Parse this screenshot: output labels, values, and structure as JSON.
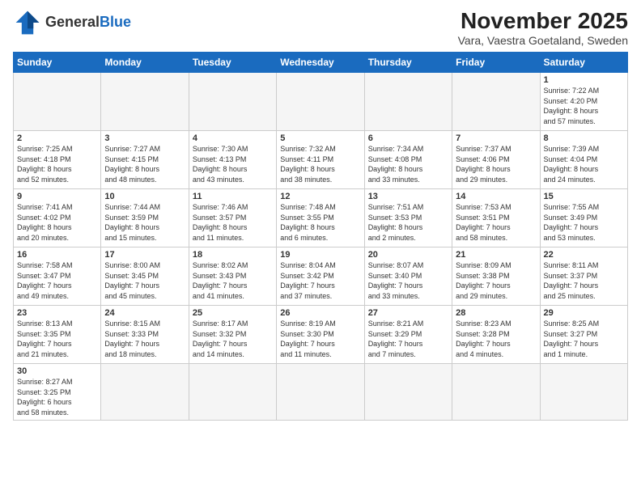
{
  "header": {
    "logo_general": "General",
    "logo_blue": "Blue",
    "title": "November 2025",
    "subtitle": "Vara, Vaestra Goetaland, Sweden"
  },
  "weekdays": [
    "Sunday",
    "Monday",
    "Tuesday",
    "Wednesday",
    "Thursday",
    "Friday",
    "Saturday"
  ],
  "weeks": [
    [
      {
        "day": "",
        "info": "",
        "empty": true
      },
      {
        "day": "",
        "info": "",
        "empty": true
      },
      {
        "day": "",
        "info": "",
        "empty": true
      },
      {
        "day": "",
        "info": "",
        "empty": true
      },
      {
        "day": "",
        "info": "",
        "empty": true
      },
      {
        "day": "",
        "info": "",
        "empty": true
      },
      {
        "day": "1",
        "info": "Sunrise: 7:22 AM\nSunset: 4:20 PM\nDaylight: 8 hours\nand 57 minutes."
      }
    ],
    [
      {
        "day": "2",
        "info": "Sunrise: 7:25 AM\nSunset: 4:18 PM\nDaylight: 8 hours\nand 52 minutes."
      },
      {
        "day": "3",
        "info": "Sunrise: 7:27 AM\nSunset: 4:15 PM\nDaylight: 8 hours\nand 48 minutes."
      },
      {
        "day": "4",
        "info": "Sunrise: 7:30 AM\nSunset: 4:13 PM\nDaylight: 8 hours\nand 43 minutes."
      },
      {
        "day": "5",
        "info": "Sunrise: 7:32 AM\nSunset: 4:11 PM\nDaylight: 8 hours\nand 38 minutes."
      },
      {
        "day": "6",
        "info": "Sunrise: 7:34 AM\nSunset: 4:08 PM\nDaylight: 8 hours\nand 33 minutes."
      },
      {
        "day": "7",
        "info": "Sunrise: 7:37 AM\nSunset: 4:06 PM\nDaylight: 8 hours\nand 29 minutes."
      },
      {
        "day": "8",
        "info": "Sunrise: 7:39 AM\nSunset: 4:04 PM\nDaylight: 8 hours\nand 24 minutes."
      }
    ],
    [
      {
        "day": "9",
        "info": "Sunrise: 7:41 AM\nSunset: 4:02 PM\nDaylight: 8 hours\nand 20 minutes."
      },
      {
        "day": "10",
        "info": "Sunrise: 7:44 AM\nSunset: 3:59 PM\nDaylight: 8 hours\nand 15 minutes."
      },
      {
        "day": "11",
        "info": "Sunrise: 7:46 AM\nSunset: 3:57 PM\nDaylight: 8 hours\nand 11 minutes."
      },
      {
        "day": "12",
        "info": "Sunrise: 7:48 AM\nSunset: 3:55 PM\nDaylight: 8 hours\nand 6 minutes."
      },
      {
        "day": "13",
        "info": "Sunrise: 7:51 AM\nSunset: 3:53 PM\nDaylight: 8 hours\nand 2 minutes."
      },
      {
        "day": "14",
        "info": "Sunrise: 7:53 AM\nSunset: 3:51 PM\nDaylight: 7 hours\nand 58 minutes."
      },
      {
        "day": "15",
        "info": "Sunrise: 7:55 AM\nSunset: 3:49 PM\nDaylight: 7 hours\nand 53 minutes."
      }
    ],
    [
      {
        "day": "16",
        "info": "Sunrise: 7:58 AM\nSunset: 3:47 PM\nDaylight: 7 hours\nand 49 minutes."
      },
      {
        "day": "17",
        "info": "Sunrise: 8:00 AM\nSunset: 3:45 PM\nDaylight: 7 hours\nand 45 minutes."
      },
      {
        "day": "18",
        "info": "Sunrise: 8:02 AM\nSunset: 3:43 PM\nDaylight: 7 hours\nand 41 minutes."
      },
      {
        "day": "19",
        "info": "Sunrise: 8:04 AM\nSunset: 3:42 PM\nDaylight: 7 hours\nand 37 minutes."
      },
      {
        "day": "20",
        "info": "Sunrise: 8:07 AM\nSunset: 3:40 PM\nDaylight: 7 hours\nand 33 minutes."
      },
      {
        "day": "21",
        "info": "Sunrise: 8:09 AM\nSunset: 3:38 PM\nDaylight: 7 hours\nand 29 minutes."
      },
      {
        "day": "22",
        "info": "Sunrise: 8:11 AM\nSunset: 3:37 PM\nDaylight: 7 hours\nand 25 minutes."
      }
    ],
    [
      {
        "day": "23",
        "info": "Sunrise: 8:13 AM\nSunset: 3:35 PM\nDaylight: 7 hours\nand 21 minutes."
      },
      {
        "day": "24",
        "info": "Sunrise: 8:15 AM\nSunset: 3:33 PM\nDaylight: 7 hours\nand 18 minutes."
      },
      {
        "day": "25",
        "info": "Sunrise: 8:17 AM\nSunset: 3:32 PM\nDaylight: 7 hours\nand 14 minutes."
      },
      {
        "day": "26",
        "info": "Sunrise: 8:19 AM\nSunset: 3:30 PM\nDaylight: 7 hours\nand 11 minutes."
      },
      {
        "day": "27",
        "info": "Sunrise: 8:21 AM\nSunset: 3:29 PM\nDaylight: 7 hours\nand 7 minutes."
      },
      {
        "day": "28",
        "info": "Sunrise: 8:23 AM\nSunset: 3:28 PM\nDaylight: 7 hours\nand 4 minutes."
      },
      {
        "day": "29",
        "info": "Sunrise: 8:25 AM\nSunset: 3:27 PM\nDaylight: 7 hours\nand 1 minute."
      }
    ],
    [
      {
        "day": "30",
        "info": "Sunrise: 8:27 AM\nSunset: 3:25 PM\nDaylight: 6 hours\nand 58 minutes.",
        "last": true
      },
      {
        "day": "",
        "info": "",
        "empty": true,
        "last": true
      },
      {
        "day": "",
        "info": "",
        "empty": true,
        "last": true
      },
      {
        "day": "",
        "info": "",
        "empty": true,
        "last": true
      },
      {
        "day": "",
        "info": "",
        "empty": true,
        "last": true
      },
      {
        "day": "",
        "info": "",
        "empty": true,
        "last": true
      },
      {
        "day": "",
        "info": "",
        "empty": true,
        "last": true
      }
    ]
  ]
}
